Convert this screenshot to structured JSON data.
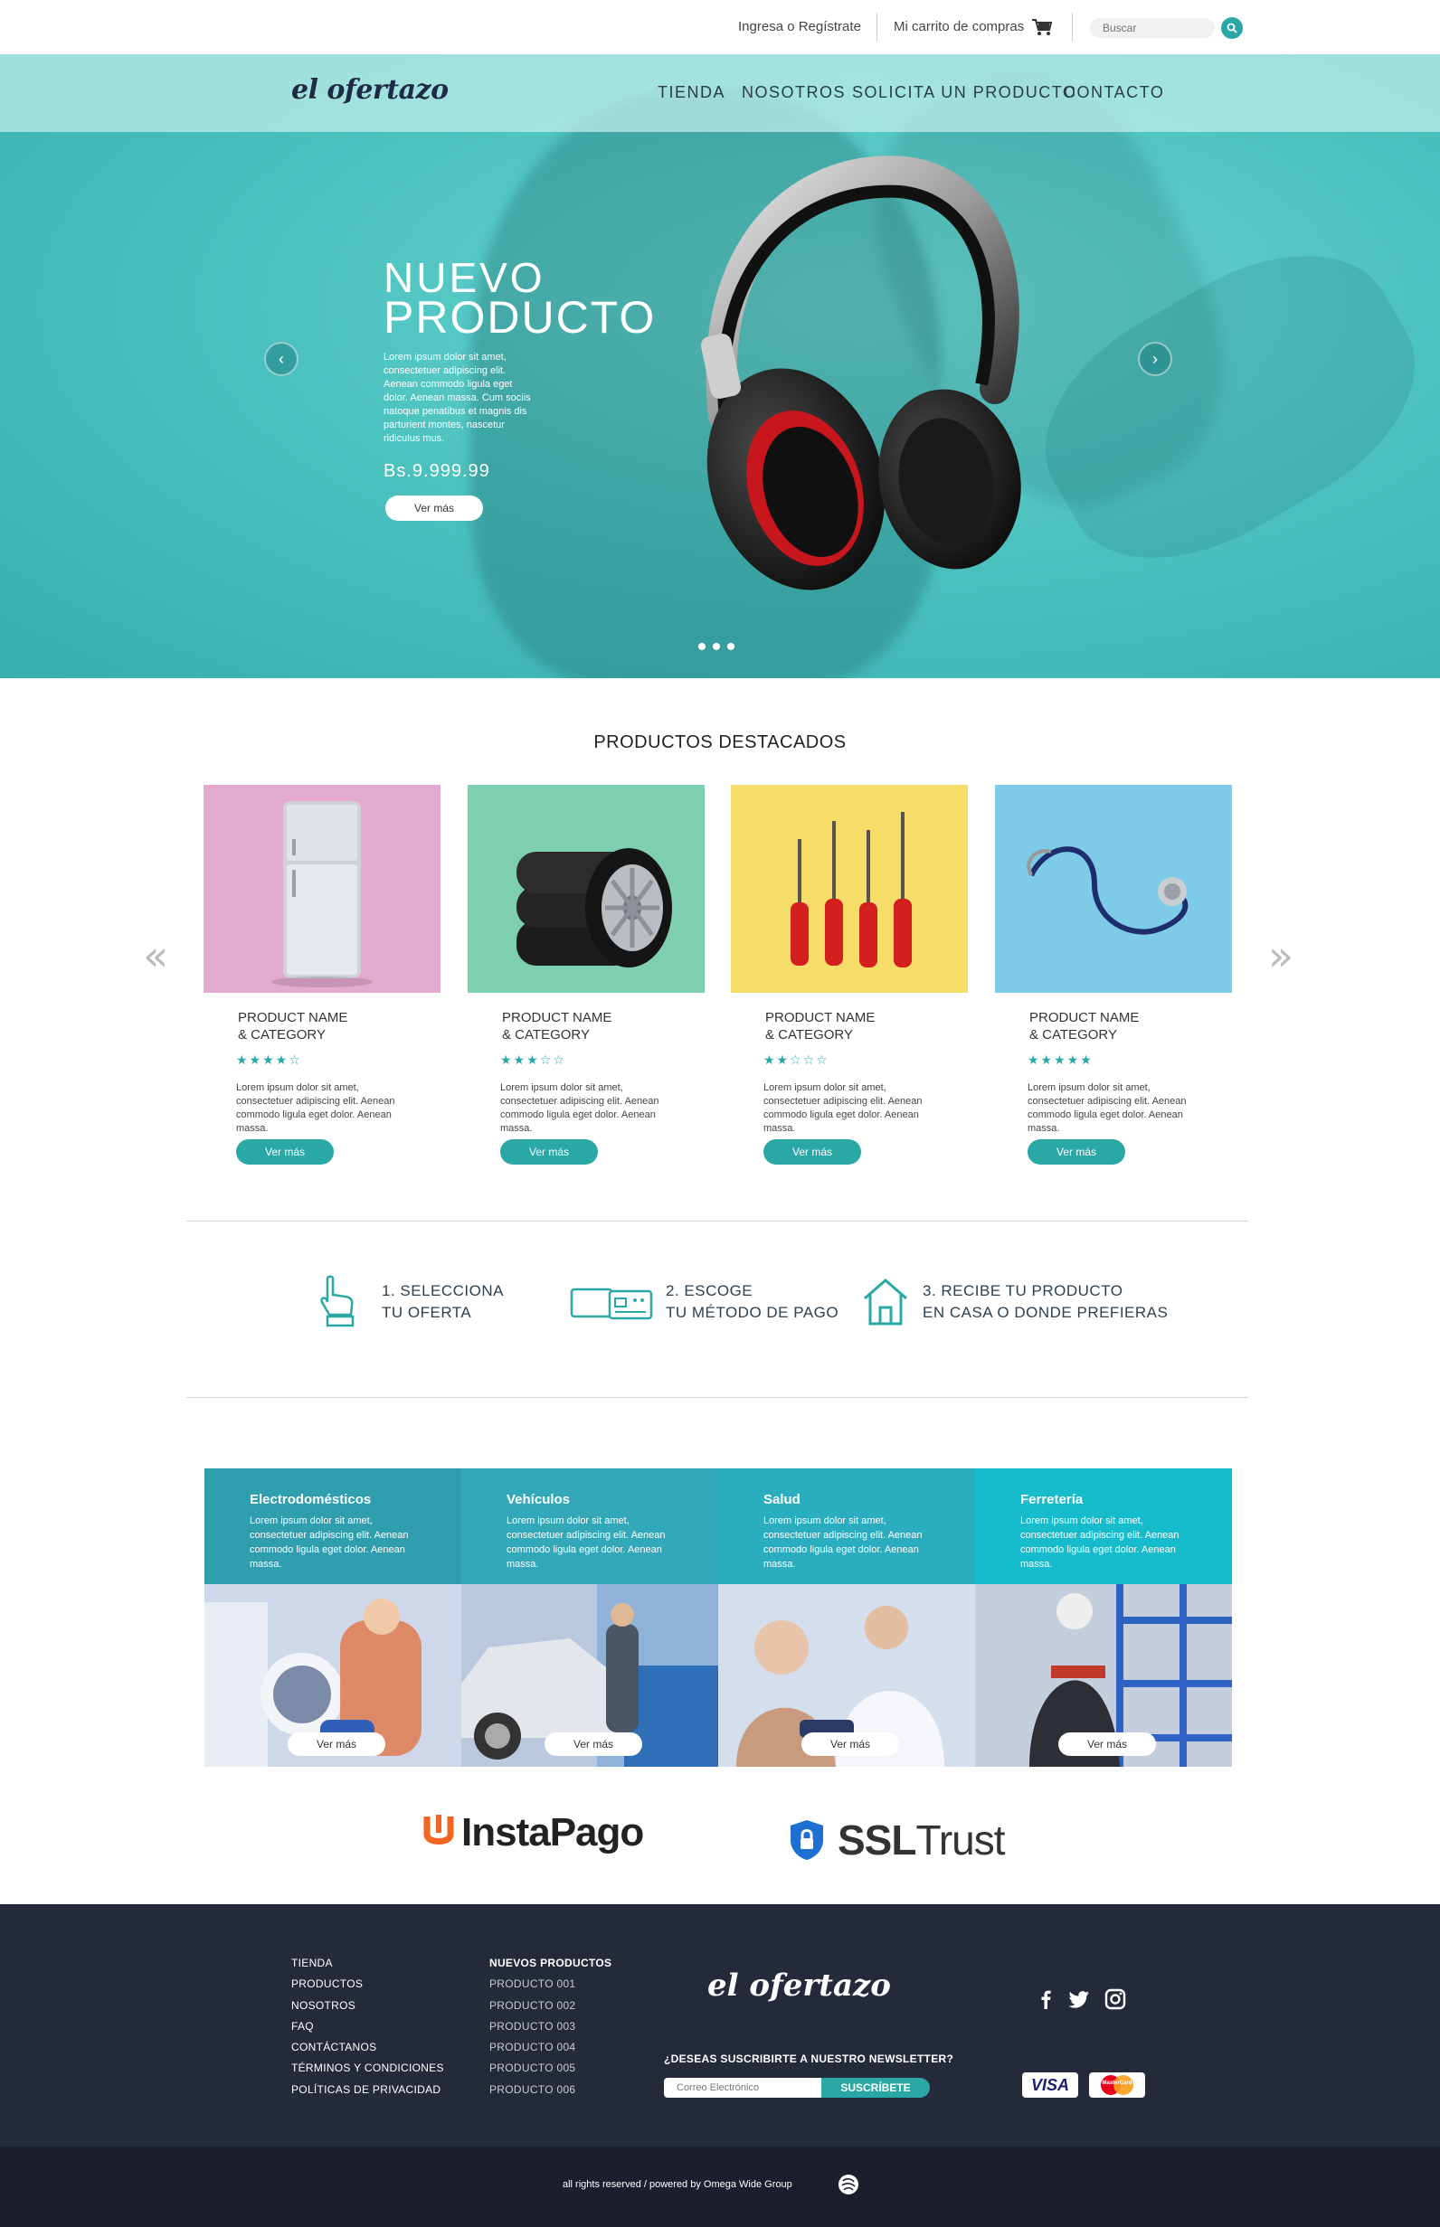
{
  "topbar": {
    "login": "Ingresa o Regístrate",
    "cart": "Mi carrito de compras",
    "search_placeholder": "Buscar"
  },
  "brand": {
    "logo": "el ofertazo",
    "accent": "#2aa8a6",
    "footer_bg": "#252a3b"
  },
  "nav": {
    "items": [
      "TIENDA",
      "NOSOTROS",
      "SOLICITA UN PRODUCTO",
      "CONTACTO"
    ]
  },
  "hero": {
    "title_line1": "NUEVO",
    "title_line2": "PRODUCTO",
    "description": "Lorem ipsum dolor sit amet, consectetuer adipiscing elit. Aenean commodo ligula eget dolor. Aenean massa. Cum sociis natoque penatibus et magnis dis parturient montes, nascetur ridiculus mus.",
    "price": "Bs.9.999.99",
    "button": "Ver más",
    "prev_icon": "‹",
    "next_icon": "›",
    "slides": 3
  },
  "featured": {
    "title": "PRODUCTOS DESTACADOS",
    "prev_icon": "«",
    "next_icon": "»",
    "products": [
      {
        "name_line1": "PRODUCT NAME",
        "name_line2": "& CATEGORY",
        "rating": 4,
        "stars": "★★★★☆",
        "desc": "Lorem ipsum dolor sit amet, consectetuer adipiscing elit. Aenean commodo ligula eget dolor. Aenean massa.",
        "button": "Ver más",
        "bg": "#e4a9cf",
        "image": "refrigerator"
      },
      {
        "name_line1": "PRODUCT NAME",
        "name_line2": "& CATEGORY",
        "rating": 3,
        "stars": "★★★☆☆",
        "desc": "Lorem ipsum dolor sit amet, consectetuer adipiscing elit. Aenean commodo ligula eget dolor. Aenean massa.",
        "button": "Ver más",
        "bg": "#7ecfb0",
        "image": "tires"
      },
      {
        "name_line1": "PRODUCT NAME",
        "name_line2": "& CATEGORY",
        "rating": 2,
        "stars": "★★☆☆☆",
        "desc": "Lorem ipsum dolor sit amet, consectetuer adipiscing elit. Aenean commodo ligula eget dolor. Aenean massa.",
        "button": "Ver más",
        "bg": "#f6dc68",
        "image": "screwdrivers"
      },
      {
        "name_line1": "PRODUCT NAME",
        "name_line2": "& CATEGORY",
        "rating": 5,
        "stars": "★★★★★",
        "desc": "Lorem ipsum dolor sit amet, consectetuer adipiscing elit. Aenean commodo ligula eget dolor. Aenean massa.",
        "button": "Ver más",
        "bg": "#7dcbe6",
        "image": "stethoscope"
      }
    ]
  },
  "steps": [
    {
      "line1": "1. SELECCIONA",
      "line2": "TU OFERTA",
      "icon": "hand-pointer-icon"
    },
    {
      "line1": "2. ESCOGE",
      "line2": "TU MÉTODO DE PAGO",
      "icon": "payment-card-icon"
    },
    {
      "line1": "3. RECIBE TU PRODUCTO",
      "line2": "EN CASA O DONDE PREFIERAS",
      "icon": "house-icon"
    }
  ],
  "categories": [
    {
      "title": "Electrodomésticos",
      "desc": "Lorem ipsum dolor sit amet, consectetuer adipiscing elit. Aenean commodo ligula eget dolor. Aenean massa.",
      "button": "Ver más",
      "head_color": "#2f9fb0"
    },
    {
      "title": "Vehículos",
      "desc": "Lorem ipsum dolor sit amet, consectetuer adipiscing elit. Aenean commodo ligula eget dolor. Aenean massa.",
      "button": "Ver más",
      "head_color": "#33a8b8"
    },
    {
      "title": "Salud",
      "desc": "Lorem ipsum dolor sit amet, consectetuer adipiscing elit. Aenean commodo ligula eget dolor. Aenean massa.",
      "button": "Ver más",
      "head_color": "#2badc0"
    },
    {
      "title": "Ferretería",
      "desc": "Lorem ipsum dolor sit amet, consectetuer adipiscing elit. Aenean commodo ligula eget dolor. Aenean massa.",
      "button": "Ver más",
      "head_color": "#16bccc"
    }
  ],
  "partners": {
    "instapago": "InstaPago",
    "ssl_bold": "SSL",
    "ssl_light": "Trust"
  },
  "footer": {
    "links": [
      "TIENDA",
      "PRODUCTOS",
      "NOSOTROS",
      "FAQ",
      "CONTÁCTANOS",
      "TÉRMINOS Y CONDICIONES",
      "POLÍTICAS DE PRIVACIDAD"
    ],
    "new_heading": "NUEVOS PRODUCTOS",
    "new_products": [
      "PRODUCTO 001",
      "PRODUCTO 002",
      "PRODUCTO 003",
      "PRODUCTO 004",
      "PRODUCTO 005",
      "PRODUCTO 006"
    ],
    "newsletter_question": "¿DESEAS SUSCRIBIRTE A NUESTRO NEWSLETTER?",
    "email_placeholder": "Correo Electrónico",
    "subscribe": "SUSCRÍBETE",
    "social": [
      "facebook-icon",
      "twitter-icon",
      "instagram-icon"
    ],
    "cards": [
      "VISA",
      "MasterCard"
    ],
    "copyright": "all rights reserved / powered by Omega Wide Group"
  }
}
